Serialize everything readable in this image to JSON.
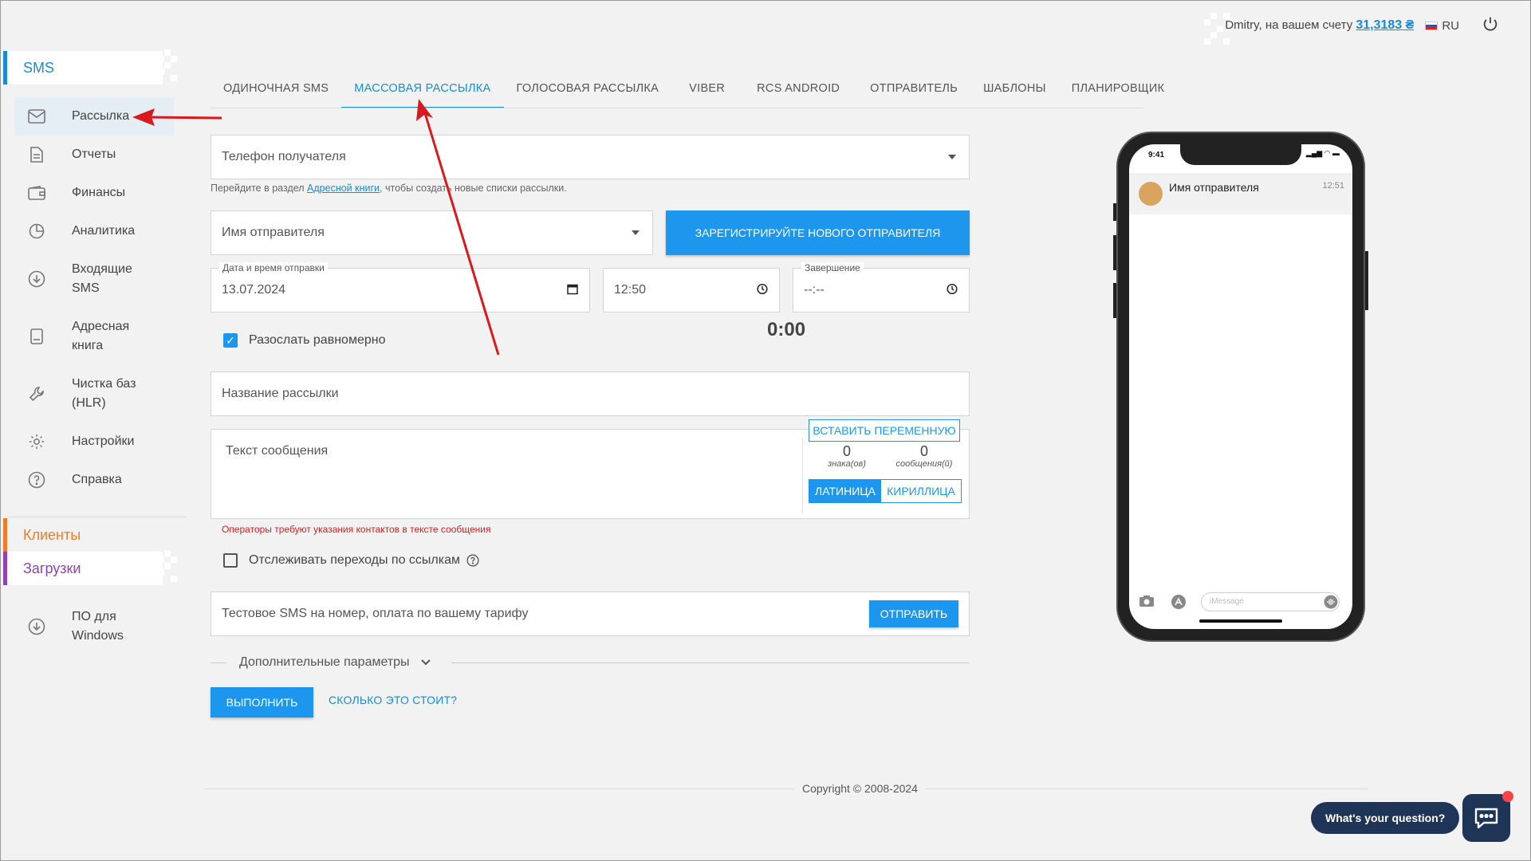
{
  "topbar": {
    "greeting": "Dmitry, на вашем счету",
    "balance": "31,3183 ₴",
    "language": "RU"
  },
  "sidebar": {
    "sms_section": "SMS",
    "items": [
      {
        "label": "Рассылка",
        "icon": "mail-icon"
      },
      {
        "label": "Отчеты",
        "icon": "document-icon"
      },
      {
        "label": "Финансы",
        "icon": "wallet-icon"
      },
      {
        "label": "Аналитика",
        "icon": "pie-chart-icon"
      },
      {
        "label": "Входящие SMS",
        "icon": "download-icon"
      },
      {
        "label": "Адресная книга",
        "icon": "book-icon"
      },
      {
        "label": "Чистка баз (HLR)",
        "icon": "wrench-icon"
      },
      {
        "label": "Настройки",
        "icon": "gear-icon"
      },
      {
        "label": "Справка",
        "icon": "help-icon"
      }
    ],
    "clients_section": "Клиенты",
    "downloads_section": "Загрузки",
    "windows_item": "ПО для Windows"
  },
  "tabs": [
    "ОДИНОЧНАЯ SMS",
    "МАССОВАЯ РАССЫЛКА",
    "ГОЛОСОВАЯ РАССЫЛКА",
    "VIBER",
    "RCS ANDROID",
    "ОТПРАВИТЕЛЬ",
    "ШАБЛОНЫ",
    "ПЛАНИРОВЩИК"
  ],
  "active_tab": "МАССОВАЯ РАССЫЛКА",
  "form": {
    "recipient_placeholder": "Телефон получателя",
    "hint_pre": "Перейдите в раздел ",
    "hint_link": "Адресной книги",
    "hint_post": ", чтобы создать новые списки рассылки.",
    "sender_placeholder": "Имя отправителя",
    "register_sender_button": "ЗАРЕГИСТРИРУЙТЕ НОВОГО ОТПРАВИТЕЛЯ",
    "date_legend": "Дата и время отправки",
    "date_value": "13.07.2024",
    "time_value": "12:50",
    "end_legend": "Завершение",
    "end_value": "--:--",
    "timer": "0:00",
    "even_send_label": "Разослать равномерно",
    "campaign_name_placeholder": "Название рассылки",
    "message_placeholder": "Текст сообщения",
    "insert_variable_button": "ВСТАВИТЬ ПЕРЕМЕННУЮ",
    "chars_count": "0",
    "chars_label": "знака(ов)",
    "messages_count": "0",
    "messages_label": "сообщения(й)",
    "latin_button": "ЛАТИНИЦА",
    "cyrillic_button": "КИРИЛЛИЦА",
    "error_text": "Операторы требуют указания контактов в тексте сообщения",
    "track_links_label": "Отслеживать переходы по ссылкам",
    "test_sms_placeholder": "Тестовое SMS на номер, оплата по вашему тарифу",
    "send_button": "ОТПРАВИТЬ",
    "advanced_label": "Дополнительные параметры",
    "execute_button": "ВЫПОЛНИТЬ",
    "cost_link": "СКОЛЬКО ЭТО СТОИТ?"
  },
  "phone_preview": {
    "status_time": "9:41",
    "sender_name": "Имя отправителя",
    "message_time": "12:51",
    "imessage_placeholder": "iMessage"
  },
  "footer": {
    "copyright": "Copyright © 2008-2024"
  },
  "chat_widget": {
    "label": "What's your question?"
  },
  "colors": {
    "accent": "#1d96ee",
    "clients": "#f07c2a",
    "downloads": "#8e44ad",
    "error": "#d42020",
    "annotation_arrow": "#d9191c"
  }
}
